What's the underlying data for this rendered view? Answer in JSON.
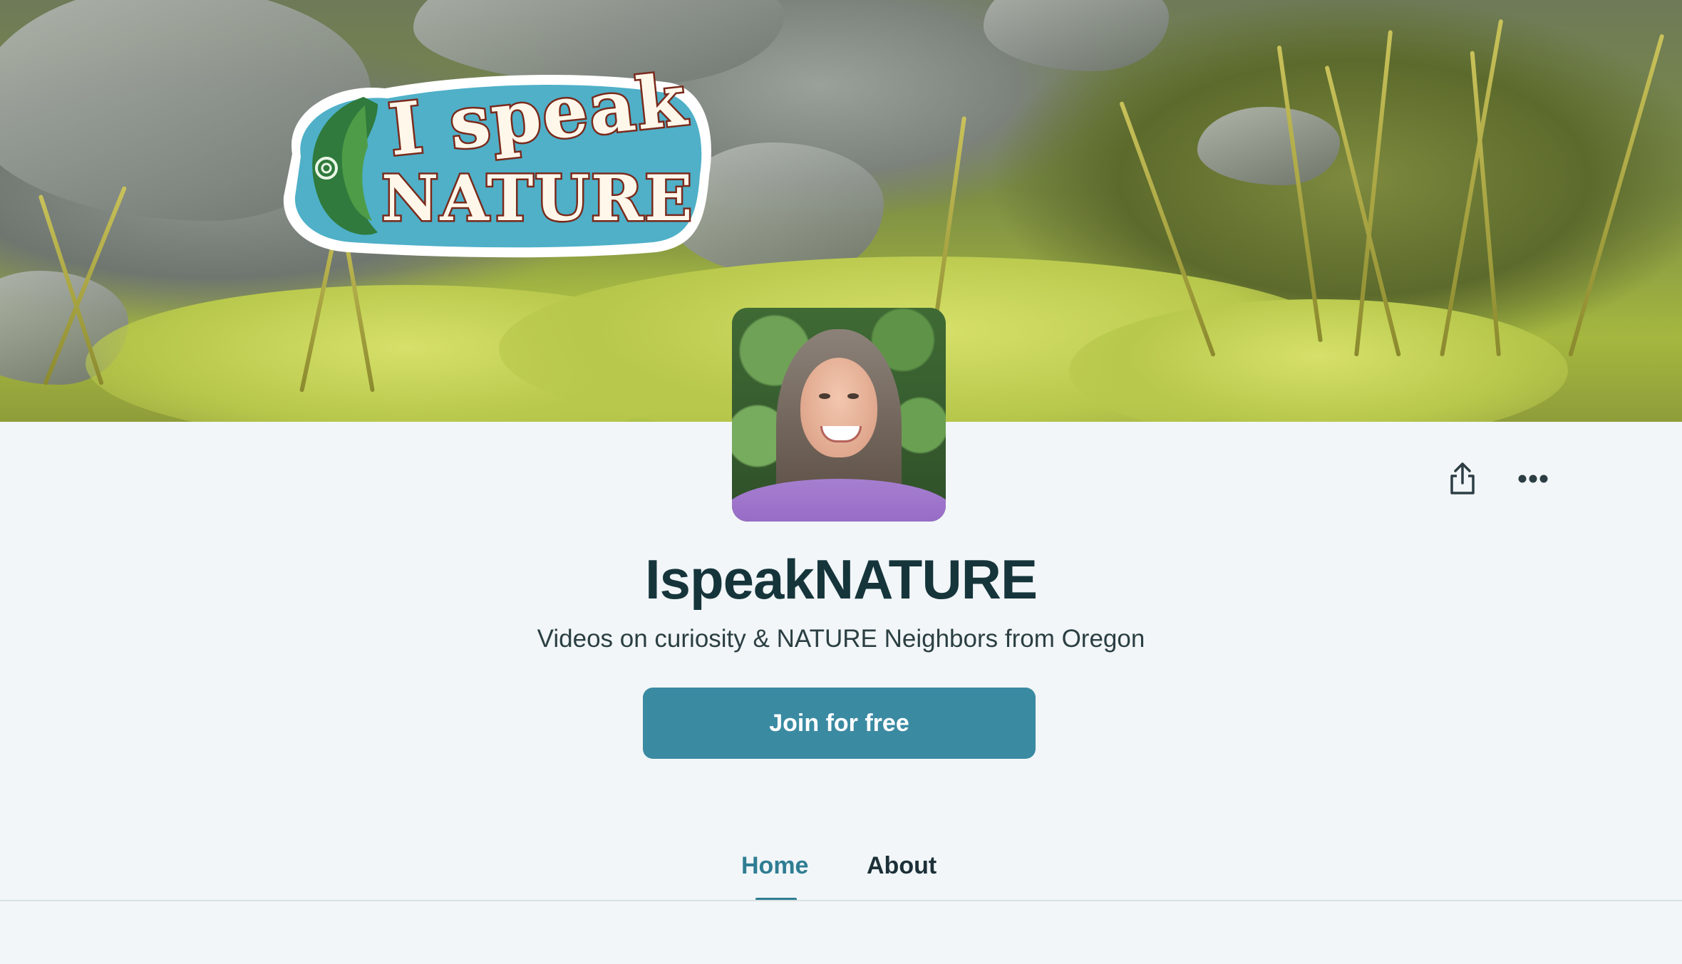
{
  "cover": {
    "logo": {
      "line1": "I speak",
      "line2": "NATURE"
    }
  },
  "profile": {
    "name": "IspeakNATURE",
    "tagline": "Videos on curiosity & NATURE Neighbors from Oregon",
    "avatar_icon": "creator-avatar"
  },
  "actions": {
    "share_icon": "share-icon",
    "more_icon": "more-options-icon"
  },
  "cta": {
    "join_label": "Join for free"
  },
  "tabs": [
    {
      "label": "Home",
      "active": true
    },
    {
      "label": "About",
      "active": false
    }
  ],
  "colors": {
    "accent": "#3a8aa2",
    "active_tab": "#2f7d93",
    "background": "#f2f6f8",
    "title_text": "#15353b"
  }
}
